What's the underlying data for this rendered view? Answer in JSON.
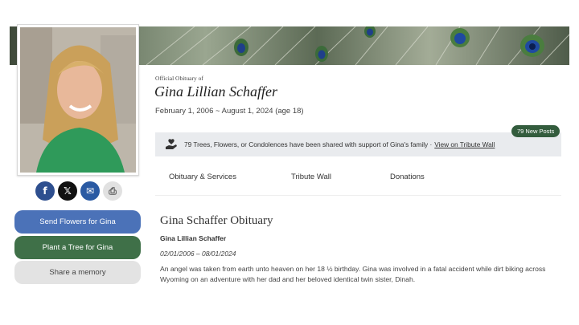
{
  "banner": {
    "image": "peacock-feathers-banner"
  },
  "profile": {
    "photo": "portrait-photo-of-gina"
  },
  "share": {
    "facebook": "f",
    "x": "𝕏",
    "email": "✉",
    "print": "⎙"
  },
  "actions": {
    "flowers_label": "Send Flowers for Gina",
    "tree_label": "Plant a Tree for Gina",
    "memory_label": "Share a memory"
  },
  "header": {
    "kicker": "Official Obituary of",
    "name": "Gina Lillian Schaffer",
    "dates": "February 1, 2006 ~ August 1, 2024 (age 18)"
  },
  "notice": {
    "text": "79 Trees, Flowers, or Condolences have been shared with support of Gina's family ·",
    "link": "View on Tribute Wall",
    "badge": "79 New Posts"
  },
  "tabs": [
    "Obituary & Services",
    "Tribute Wall",
    "Donations"
  ],
  "obituary": {
    "title": "Gina Schaffer Obituary",
    "subtitle": "Gina Lillian Schaffer",
    "dates": "02/01/2006 – 08/01/2024",
    "text": "An angel was taken from earth unto heaven on her 18 ½ birthday. Gina was involved in a fatal accident while dirt biking across Wyoming on an adventure with her dad and her beloved identical twin sister, Dinah."
  },
  "colors": {
    "flowers": "#4b72b8",
    "tree": "#3f7048",
    "badge": "#335c3d"
  }
}
